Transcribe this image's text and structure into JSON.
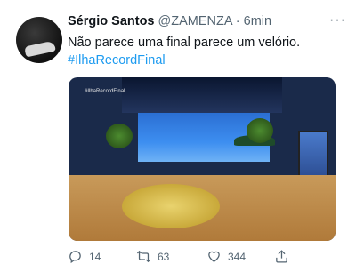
{
  "tweet": {
    "author_name": "Sérgio Santos",
    "handle": "@ZAMENZA",
    "separator": "·",
    "time": "6min",
    "text_line1": "Não parece uma final parece um velório.",
    "hashtag": "#IlhaRecordFinal",
    "media_watermark": "#IlhaRecordFinal",
    "more_icon": "more-horizontal-icon",
    "stats": {
      "replies": "14",
      "retweets": "63",
      "likes": "344"
    },
    "icons": {
      "reply": "reply-icon",
      "retweet": "retweet-icon",
      "like": "heart-icon",
      "share": "share-icon"
    }
  },
  "colors": {
    "hashtag": "#1d9bf0",
    "secondary_text": "#536471"
  }
}
